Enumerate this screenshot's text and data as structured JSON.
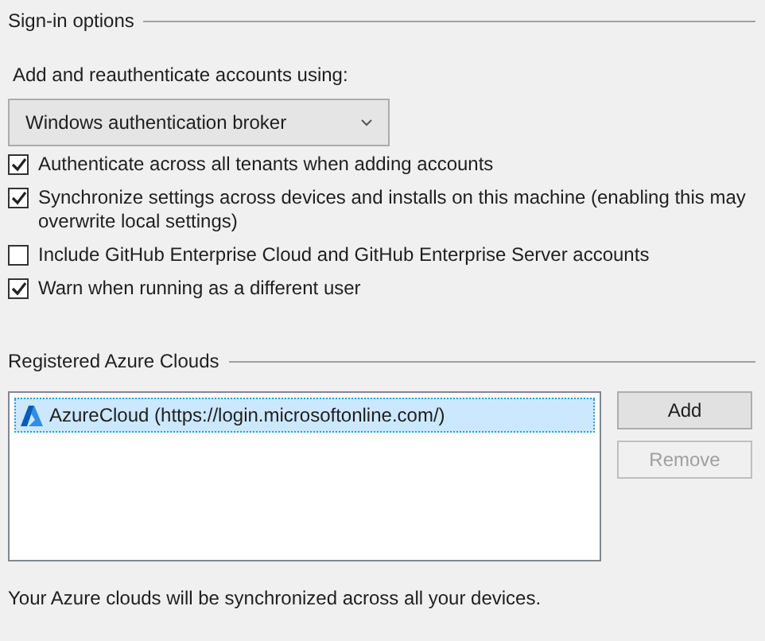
{
  "sign_in_options": {
    "heading": "Sign-in options",
    "label": "Add and reauthenticate accounts using:",
    "dropdown": {
      "value": "Windows authentication broker"
    },
    "options": [
      {
        "label": "Authenticate across all tenants when adding accounts",
        "checked": true
      },
      {
        "label": "Synchronize settings across devices and installs on this machine (enabling this may overwrite local settings)",
        "checked": true
      },
      {
        "label": "Include GitHub Enterprise Cloud and GitHub Enterprise Server accounts",
        "checked": false
      },
      {
        "label": "Warn when running as a different user",
        "checked": true
      }
    ]
  },
  "registered_azure_clouds": {
    "heading": "Registered Azure Clouds",
    "items": [
      {
        "label": "AzureCloud (https://login.microsoftonline.com/)",
        "selected": true
      }
    ],
    "buttons": [
      {
        "label": "Add",
        "disabled": false
      },
      {
        "label": "Remove",
        "disabled": true
      }
    ],
    "note": "Your Azure clouds will be synchronized across all your devices."
  }
}
